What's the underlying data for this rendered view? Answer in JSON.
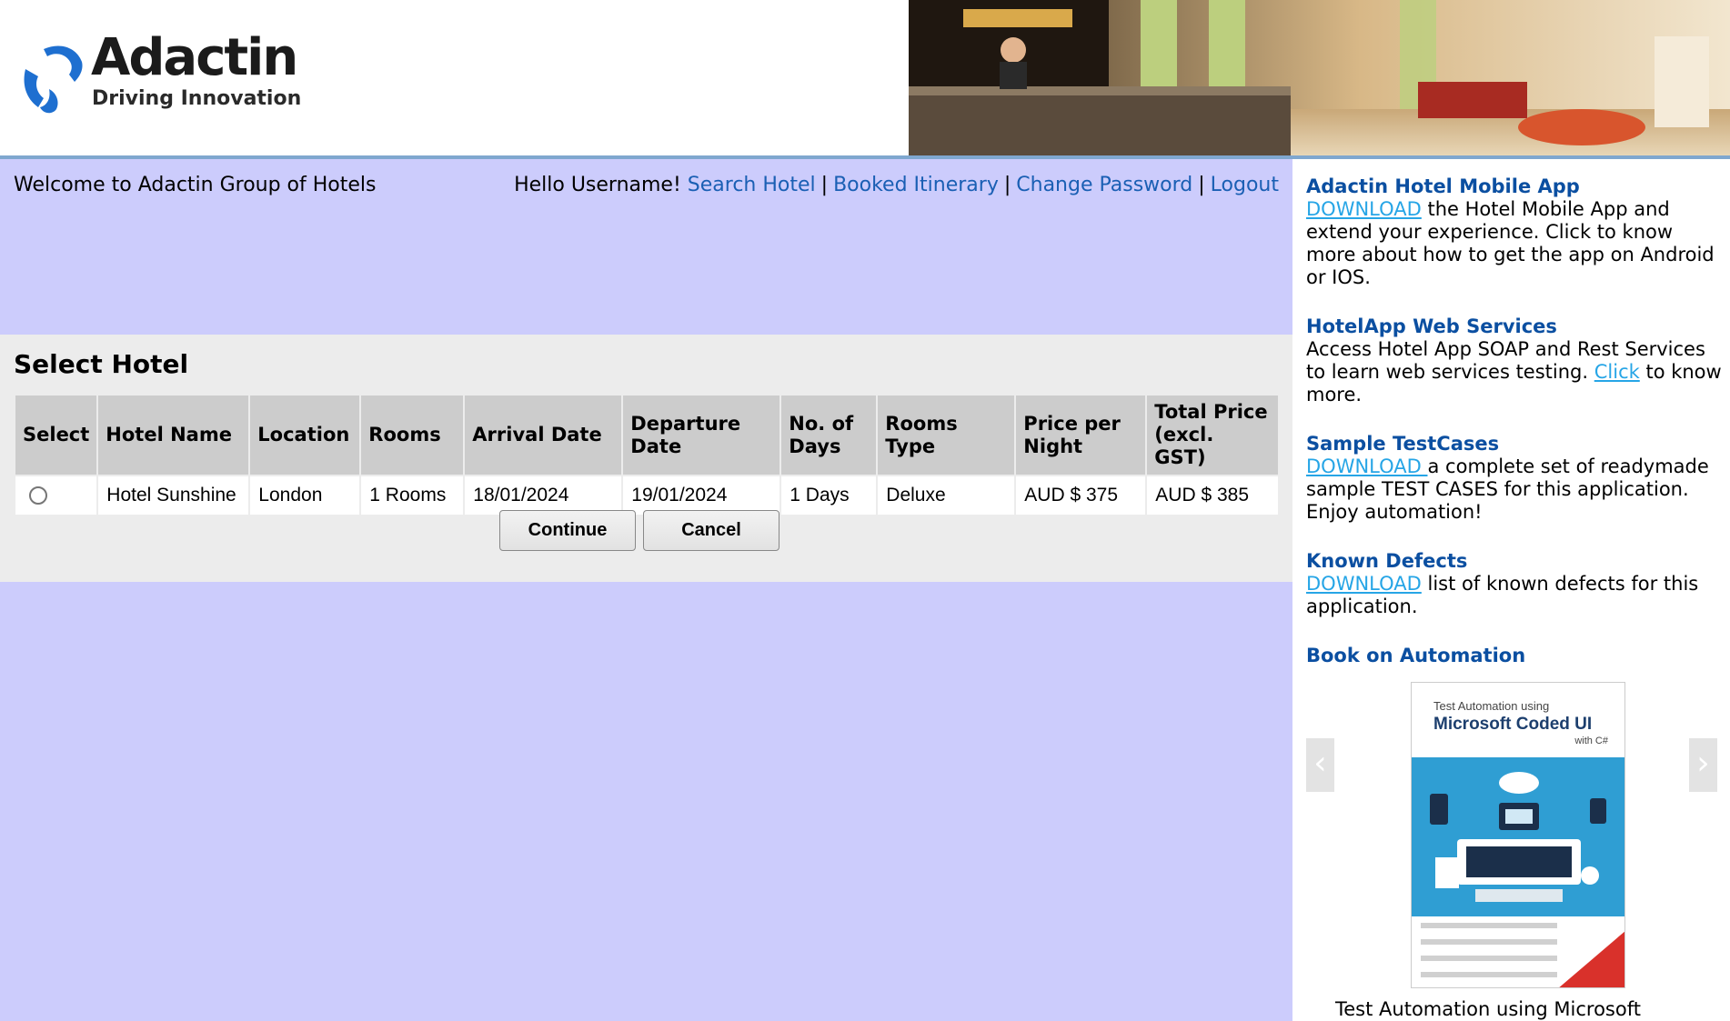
{
  "header": {
    "brand": "Adactin",
    "tagline": "Driving Innovation"
  },
  "nav": {
    "welcome": "Welcome to Adactin Group of Hotels",
    "greeting": "Hello Username!",
    "links": [
      "Search Hotel",
      "Booked Itinerary",
      "Change Password",
      "Logout"
    ],
    "separator": "|"
  },
  "select_hotel": {
    "title": "Select Hotel",
    "columns": [
      "Select",
      "Hotel Name",
      "Location",
      "Rooms",
      "Arrival Date",
      "Departure Date",
      "No. of Days",
      "Rooms Type",
      "Price per Night",
      "Total Price (excl. GST)"
    ],
    "rows": [
      {
        "selected": false,
        "hotel_name": "Hotel Sunshine",
        "location": "London",
        "rooms": "1 Rooms",
        "arrival_date": "18/01/2024",
        "departure_date": "19/01/2024",
        "days": "1 Days",
        "room_type": "Deluxe",
        "price_per_night": "AUD $ 375",
        "total_price": "AUD $ 385"
      }
    ],
    "continue_label": "Continue",
    "cancel_label": "Cancel"
  },
  "sidebar": {
    "mobile": {
      "title": "Adactin Hotel Mobile App",
      "link": "DOWNLOAD",
      "text": " the Hotel Mobile App and extend your experience. Click to know more about how to get the app on Android or IOS."
    },
    "webservices": {
      "title": "HotelApp Web Services",
      "text": "Access Hotel App SOAP and Rest Services to learn web services testing. ",
      "link": "Click",
      "text_after": " to know more."
    },
    "testcases": {
      "title": "Sample TestCases",
      "link": "DOWNLOAD ",
      "text": "a complete set of readymade sample TEST CASES for this application. Enjoy automation!"
    },
    "defects": {
      "title": "Known Defects",
      "link": "DOWNLOAD",
      "text": " list of known defects for this application."
    },
    "book": {
      "title": "Book on Automation",
      "cover_line1": "Test Automation using",
      "cover_line2": "Microsoft Coded UI",
      "cover_line3": "with C#",
      "caption": "Test Automation using Microsoft"
    }
  },
  "colors": {
    "main_bg": "#ccccfc",
    "panel_bg": "#ececec",
    "link": "#1a5fb4",
    "sidebar_title": "#0b4fa1",
    "sidebar_link": "#26a5e6"
  }
}
